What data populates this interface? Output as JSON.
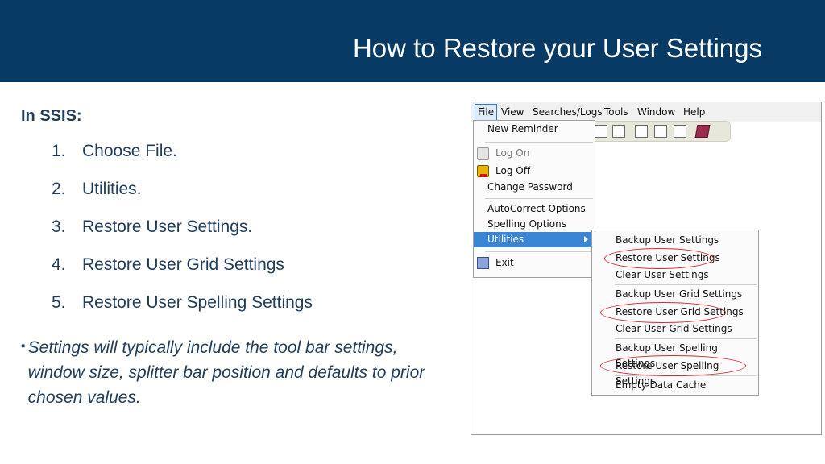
{
  "slide": {
    "title": "How to Restore your User Settings",
    "section_label": "In SSIS:",
    "steps": [
      {
        "num": "1.",
        "text": "Choose File."
      },
      {
        "num": "2.",
        "text": "Utilities."
      },
      {
        "num": "3.",
        "text": "Restore User Settings."
      },
      {
        "num": "4.",
        "text": "Restore User Grid Settings"
      },
      {
        "num": "5.",
        "text": "Restore User Spelling Settings"
      }
    ],
    "note_bullet": "▪",
    "note": "Settings will typically include the tool bar settings, window size, splitter bar position and defaults to prior chosen values.",
    "colors": {
      "header_bg": "#073b66",
      "text": "#1f3c5a",
      "highlight": "#3a86d4",
      "annotation": "#e0242b"
    }
  },
  "app": {
    "menubar": [
      "File",
      "View",
      "Searches/Logs",
      "Tools",
      "Window",
      "Help"
    ],
    "file_menu": {
      "new_reminder": "New Reminder",
      "log_on": "Log On",
      "log_off": "Log Off",
      "change_password": "Change Password",
      "autocorrect": "AutoCorrect Options",
      "spelling": "Spelling Options",
      "utilities": "Utilities",
      "exit": "Exit"
    },
    "utilities_menu": [
      "Backup User Settings",
      "Restore User Settings",
      "Clear User Settings",
      "Backup User Grid Settings",
      "Restore User Grid Settings",
      "Clear User Grid Settings",
      "Backup User Spelling Settings",
      "Restore User Spelling Settings",
      "Empty Data Cache"
    ],
    "icons": {
      "log_on": "key-gray-icon",
      "log_off": "key-gold-icon",
      "exit": "exit-door-icon",
      "submenu": "chevron-right-icon"
    }
  }
}
